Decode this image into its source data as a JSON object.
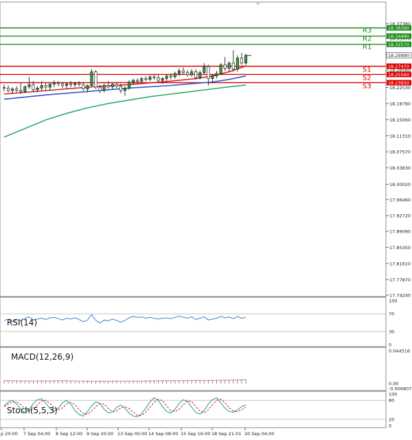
{
  "chart_data": {
    "type": "candlestick",
    "price_axis": {
      "min": 17.7424,
      "max": 18.4016,
      "ticks": [
        "18.37380",
        "18.33970",
        "18.29990",
        "18.26560",
        "18.22530",
        "18.18790",
        "18.15060",
        "18.11310",
        "18.07570",
        "18.03830",
        "18.00020",
        "17.96460",
        "17.92720",
        "17.89090",
        "17.85350",
        "17.81610",
        "17.77870",
        "17.74240"
      ]
    },
    "current_price": "18.29990",
    "levels": [
      {
        "name": "R3",
        "label": "R3",
        "value": 18.3639,
        "value_text": "18.36390",
        "kind": "resistance",
        "color": "#1a8c1a"
      },
      {
        "name": "R2",
        "label": "R2",
        "value": 18.3448,
        "value_text": "18.34480",
        "kind": "resistance",
        "color": "#1a8c1a"
      },
      {
        "name": "R1",
        "label": "R1",
        "value": 18.3257,
        "value_text": "18.32570",
        "kind": "resistance",
        "color": "#1a8c1a"
      },
      {
        "name": "S1",
        "label": "S1",
        "value": 18.2747,
        "value_text": "18.27470",
        "kind": "support",
        "color": "#dd0000"
      },
      {
        "name": "S2",
        "label": "S2",
        "value": 18.2556,
        "value_text": "18.25560",
        "kind": "support",
        "color": "#dd0000"
      },
      {
        "name": "S3",
        "label": "S3",
        "value": 18.2365,
        "value_text": "18.23650",
        "kind": "support",
        "color": "#dd0000"
      }
    ],
    "x_axis": {
      "labels": [
        "p 20:00",
        "7 Sep 04:00",
        "8 Sep 12:00",
        "9 Sep 20:00",
        "13 Sep 00:00",
        "14 Sep 08:00",
        "15 Sep 16:00",
        "18 Sep 21:01",
        "20 Sep 04:00"
      ]
    },
    "candles": [
      {
        "o": 18.225,
        "h": 18.232,
        "l": 18.216,
        "c": 18.224
      },
      {
        "o": 18.224,
        "h": 18.23,
        "l": 18.214,
        "c": 18.218
      },
      {
        "o": 18.218,
        "h": 18.226,
        "l": 18.21,
        "c": 18.222
      },
      {
        "o": 18.222,
        "h": 18.228,
        "l": 18.214,
        "c": 18.219
      },
      {
        "o": 18.219,
        "h": 18.236,
        "l": 18.21,
        "c": 18.216
      },
      {
        "o": 18.216,
        "h": 18.23,
        "l": 18.212,
        "c": 18.227
      },
      {
        "o": 18.227,
        "h": 18.25,
        "l": 18.222,
        "c": 18.232
      },
      {
        "o": 18.232,
        "h": 18.24,
        "l": 18.214,
        "c": 18.22
      },
      {
        "o": 18.22,
        "h": 18.228,
        "l": 18.214,
        "c": 18.224
      },
      {
        "o": 18.224,
        "h": 18.24,
        "l": 18.218,
        "c": 18.23
      },
      {
        "o": 18.23,
        "h": 18.236,
        "l": 18.22,
        "c": 18.226
      },
      {
        "o": 18.226,
        "h": 18.236,
        "l": 18.218,
        "c": 18.233
      },
      {
        "o": 18.233,
        "h": 18.242,
        "l": 18.226,
        "c": 18.236
      },
      {
        "o": 18.236,
        "h": 18.24,
        "l": 18.228,
        "c": 18.234
      },
      {
        "o": 18.234,
        "h": 18.238,
        "l": 18.224,
        "c": 18.23
      },
      {
        "o": 18.23,
        "h": 18.236,
        "l": 18.222,
        "c": 18.234
      },
      {
        "o": 18.234,
        "h": 18.24,
        "l": 18.226,
        "c": 18.232
      },
      {
        "o": 18.232,
        "h": 18.238,
        "l": 18.226,
        "c": 18.235
      },
      {
        "o": 18.235,
        "h": 18.24,
        "l": 18.228,
        "c": 18.232
      },
      {
        "o": 18.232,
        "h": 18.238,
        "l": 18.218,
        "c": 18.222
      },
      {
        "o": 18.222,
        "h": 18.232,
        "l": 18.214,
        "c": 18.23
      },
      {
        "o": 18.23,
        "h": 18.268,
        "l": 18.228,
        "c": 18.262
      },
      {
        "o": 18.262,
        "h": 18.266,
        "l": 18.222,
        "c": 18.226
      },
      {
        "o": 18.226,
        "h": 18.232,
        "l": 18.212,
        "c": 18.218
      },
      {
        "o": 18.218,
        "h": 18.236,
        "l": 18.214,
        "c": 18.23
      },
      {
        "o": 18.23,
        "h": 18.24,
        "l": 18.222,
        "c": 18.227
      },
      {
        "o": 18.227,
        "h": 18.236,
        "l": 18.22,
        "c": 18.233
      },
      {
        "o": 18.233,
        "h": 18.238,
        "l": 18.224,
        "c": 18.228
      },
      {
        "o": 18.228,
        "h": 18.234,
        "l": 18.212,
        "c": 18.218
      },
      {
        "o": 18.218,
        "h": 18.228,
        "l": 18.206,
        "c": 18.224
      },
      {
        "o": 18.224,
        "h": 18.242,
        "l": 18.22,
        "c": 18.238
      },
      {
        "o": 18.238,
        "h": 18.246,
        "l": 18.232,
        "c": 18.242
      },
      {
        "o": 18.242,
        "h": 18.246,
        "l": 18.236,
        "c": 18.24
      },
      {
        "o": 18.24,
        "h": 18.25,
        "l": 18.236,
        "c": 18.246
      },
      {
        "o": 18.246,
        "h": 18.252,
        "l": 18.24,
        "c": 18.244
      },
      {
        "o": 18.244,
        "h": 18.254,
        "l": 18.24,
        "c": 18.25
      },
      {
        "o": 18.25,
        "h": 18.256,
        "l": 18.244,
        "c": 18.248
      },
      {
        "o": 18.248,
        "h": 18.254,
        "l": 18.238,
        "c": 18.242
      },
      {
        "o": 18.242,
        "h": 18.25,
        "l": 18.234,
        "c": 18.246
      },
      {
        "o": 18.246,
        "h": 18.256,
        "l": 18.24,
        "c": 18.252
      },
      {
        "o": 18.252,
        "h": 18.258,
        "l": 18.244,
        "c": 18.25
      },
      {
        "o": 18.25,
        "h": 18.262,
        "l": 18.246,
        "c": 18.258
      },
      {
        "o": 18.258,
        "h": 18.27,
        "l": 18.252,
        "c": 18.264
      },
      {
        "o": 18.264,
        "h": 18.272,
        "l": 18.256,
        "c": 18.26
      },
      {
        "o": 18.26,
        "h": 18.266,
        "l": 18.25,
        "c": 18.255
      },
      {
        "o": 18.255,
        "h": 18.268,
        "l": 18.25,
        "c": 18.262
      },
      {
        "o": 18.262,
        "h": 18.268,
        "l": 18.244,
        "c": 18.248
      },
      {
        "o": 18.248,
        "h": 18.264,
        "l": 18.244,
        "c": 18.26
      },
      {
        "o": 18.26,
        "h": 18.282,
        "l": 18.256,
        "c": 18.274
      },
      {
        "o": 18.274,
        "h": 18.278,
        "l": 18.23,
        "c": 18.246
      },
      {
        "o": 18.246,
        "h": 18.256,
        "l": 18.236,
        "c": 18.252
      },
      {
        "o": 18.252,
        "h": 18.264,
        "l": 18.246,
        "c": 18.258
      },
      {
        "o": 18.258,
        "h": 18.282,
        "l": 18.254,
        "c": 18.278
      },
      {
        "o": 18.278,
        "h": 18.296,
        "l": 18.264,
        "c": 18.27
      },
      {
        "o": 18.27,
        "h": 18.286,
        "l": 18.262,
        "c": 18.282
      },
      {
        "o": 18.282,
        "h": 18.312,
        "l": 18.262,
        "c": 18.268
      },
      {
        "o": 18.268,
        "h": 18.3,
        "l": 18.262,
        "c": 18.294
      },
      {
        "o": 18.294,
        "h": 18.306,
        "l": 18.278,
        "c": 18.282
      },
      {
        "o": 18.282,
        "h": 18.304,
        "l": 18.278,
        "c": 18.3
      }
    ],
    "moving_averages": [
      {
        "color": "#cc2222",
        "points": [
          [
            0,
            18.21
          ],
          [
            10,
            18.218
          ],
          [
            20,
            18.226
          ],
          [
            30,
            18.232
          ],
          [
            40,
            18.24
          ],
          [
            46,
            18.246
          ],
          [
            50,
            18.252
          ],
          [
            54,
            18.262
          ],
          [
            58,
            18.275
          ]
        ]
      },
      {
        "color": "#3355cc",
        "points": [
          [
            0,
            18.198
          ],
          [
            10,
            18.208
          ],
          [
            20,
            18.216
          ],
          [
            30,
            18.224
          ],
          [
            40,
            18.23
          ],
          [
            46,
            18.235
          ],
          [
            50,
            18.238
          ],
          [
            54,
            18.244
          ],
          [
            58,
            18.252
          ]
        ]
      },
      {
        "color": "#33aa66",
        "points": [
          [
            0,
            18.11
          ],
          [
            5,
            18.13
          ],
          [
            10,
            18.15
          ],
          [
            15,
            18.165
          ],
          [
            20,
            18.178
          ],
          [
            25,
            18.188
          ],
          [
            30,
            18.196
          ],
          [
            35,
            18.204
          ],
          [
            40,
            18.21
          ],
          [
            45,
            18.216
          ],
          [
            50,
            18.222
          ],
          [
            55,
            18.228
          ],
          [
            58,
            18.231
          ]
        ]
      }
    ],
    "indicators": {
      "rsi": {
        "label": "RSI(14)",
        "range": [
          0,
          100
        ],
        "ticks": [
          "100",
          "70",
          "30",
          "0"
        ],
        "levels": [
          70,
          30
        ],
        "color": "#3a7fd5",
        "values": [
          55,
          58,
          52,
          57,
          54,
          60,
          63,
          56,
          58,
          60,
          57,
          61,
          62,
          59,
          56,
          60,
          58,
          61,
          57,
          52,
          56,
          68,
          55,
          49,
          56,
          54,
          58,
          55,
          51,
          55,
          61,
          64,
          62,
          63,
          60,
          62,
          60,
          58,
          60,
          61,
          59,
          62,
          65,
          62,
          60,
          63,
          57,
          60,
          63,
          56,
          58,
          60,
          64,
          61,
          63,
          59,
          64,
          60,
          62
        ]
      },
      "macd": {
        "label": "MACD(12,26,9)",
        "ticks": [
          "0.044516",
          "0.00",
          "-0.006807"
        ],
        "range": [
          -0.006807,
          0.044516
        ],
        "color": "#cc2222",
        "histogram": [
          0.004,
          0.0038,
          0.0037,
          0.0036,
          0.0036,
          0.0035,
          0.0036,
          0.0035,
          0.0035,
          0.0035,
          0.0036,
          0.0036,
          0.0036,
          0.0037,
          0.0036,
          0.0036,
          0.0035,
          0.0035,
          0.0034,
          0.0033,
          0.0032,
          0.0031,
          0.003,
          0.003,
          0.0031,
          0.0032,
          0.0032,
          0.0033,
          0.0032,
          0.0032,
          0.0032,
          0.0033,
          0.0034,
          0.0035,
          0.0035,
          0.0036,
          0.0036,
          0.0037,
          0.0037,
          0.0038,
          0.0038,
          0.0039,
          0.004,
          0.004,
          0.0041,
          0.0041,
          0.0042,
          0.0042,
          0.0043,
          0.0043,
          0.0043,
          0.0044,
          0.0045,
          0.0046,
          0.0047,
          0.0048,
          0.005,
          0.0052,
          0.0055
        ],
        "signal": [
          0.0038,
          0.0037,
          0.0037,
          0.0036,
          0.0035,
          0.0035,
          0.0035,
          0.0035,
          0.0035,
          0.0035,
          0.0035,
          0.0035,
          0.0036,
          0.0036,
          0.0036,
          0.0036,
          0.0035,
          0.0035,
          0.0034,
          0.0033,
          0.0032,
          0.0031,
          0.0031,
          0.0031,
          0.0031,
          0.0031,
          0.0032,
          0.0032,
          0.0032,
          0.0032,
          0.0032,
          0.0033,
          0.0033,
          0.0034,
          0.0035,
          0.0035,
          0.0036,
          0.0036,
          0.0037,
          0.0037,
          0.0038,
          0.0038,
          0.0039,
          0.004,
          0.004,
          0.0041,
          0.0041,
          0.0042,
          0.0042,
          0.0042,
          0.0043,
          0.0043,
          0.0044,
          0.0045,
          0.0046,
          0.0047,
          0.0048,
          0.005,
          0.0052
        ]
      },
      "stoch": {
        "label": "Stoch(5,5,3)",
        "range": [
          0,
          100
        ],
        "ticks": [
          "100",
          "80",
          "20",
          "0"
        ],
        "levels": [
          80,
          20
        ],
        "k_color": "#1a9a9a",
        "d_color": "#cc2222",
        "k": [
          62,
          75,
          80,
          68,
          52,
          40,
          50,
          70,
          82,
          85,
          70,
          55,
          45,
          55,
          72,
          80,
          68,
          48,
          35,
          30,
          45,
          62,
          75,
          70,
          52,
          40,
          42,
          58,
          65,
          55,
          40,
          30,
          28,
          38,
          55,
          75,
          88,
          80,
          60,
          45,
          40,
          52,
          70,
          82,
          76,
          58,
          42,
          36,
          48,
          68,
          82,
          88,
          72,
          55,
          45,
          42,
          50,
          60,
          65
        ],
        "d": [
          60,
          68,
          74,
          75,
          66,
          54,
          46,
          52,
          66,
          78,
          80,
          70,
          56,
          50,
          56,
          68,
          74,
          66,
          50,
          38,
          36,
          46,
          60,
          70,
          68,
          54,
          44,
          46,
          56,
          60,
          54,
          42,
          32,
          32,
          42,
          58,
          74,
          84,
          78,
          62,
          48,
          44,
          52,
          66,
          78,
          76,
          60,
          46,
          40,
          50,
          66,
          80,
          84,
          72,
          56,
          46,
          44,
          50,
          58
        ]
      }
    }
  }
}
